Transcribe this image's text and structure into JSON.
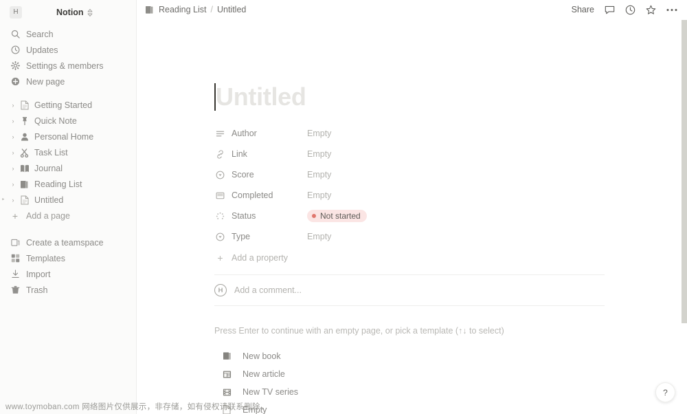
{
  "sidebar": {
    "workspace": {
      "avatar_initial": "H",
      "name": "Notion",
      "switcher_icon": "chevron-updown-icon"
    },
    "nav": [
      {
        "label": "Search",
        "icon": "search-icon"
      },
      {
        "label": "Updates",
        "icon": "clock-icon"
      },
      {
        "label": "Settings & members",
        "icon": "gear-icon"
      },
      {
        "label": "New page",
        "icon": "plus-circle-icon"
      }
    ],
    "pages": [
      {
        "label": "Getting Started",
        "icon": "document-icon"
      },
      {
        "label": "Quick Note",
        "icon": "pushpin-icon"
      },
      {
        "label": "Personal Home",
        "icon": "person-icon"
      },
      {
        "label": "Task List",
        "icon": "scissors-icon"
      },
      {
        "label": "Journal",
        "icon": "open-book-icon"
      },
      {
        "label": "Reading List",
        "icon": "books-icon"
      },
      {
        "label": "Untitled",
        "icon": "document-icon"
      }
    ],
    "add_page": {
      "label": "Add a page",
      "icon": "plus-icon"
    },
    "footer": [
      {
        "label": "Create a teamspace",
        "icon": "teamspace-icon"
      },
      {
        "label": "Templates",
        "icon": "templates-icon"
      },
      {
        "label": "Import",
        "icon": "import-icon"
      },
      {
        "label": "Trash",
        "icon": "trash-icon"
      }
    ]
  },
  "topbar": {
    "breadcrumb_parent": "Reading List",
    "breadcrumb_parent_icon": "books-icon",
    "breadcrumb_separator": "/",
    "breadcrumb_current": "Untitled",
    "share_label": "Share",
    "actions": [
      {
        "name": "comment-icon"
      },
      {
        "name": "updates-clock-icon"
      },
      {
        "name": "star-icon"
      },
      {
        "name": "more-options-icon"
      }
    ]
  },
  "page": {
    "title_placeholder": "Untitled",
    "properties": [
      {
        "label": "Author",
        "icon": "text-lines-icon",
        "value": "Empty",
        "type": "text"
      },
      {
        "label": "Link",
        "icon": "link-icon",
        "value": "Empty",
        "type": "text"
      },
      {
        "label": "Score",
        "icon": "select-icon",
        "value": "Empty",
        "type": "text"
      },
      {
        "label": "Completed",
        "icon": "checkbox-icon",
        "value": "Empty",
        "type": "text"
      },
      {
        "label": "Status",
        "icon": "status-spinner-icon",
        "value": "Not started",
        "type": "badge"
      },
      {
        "label": "Type",
        "icon": "select-icon",
        "value": "Empty",
        "type": "text"
      }
    ],
    "add_property_label": "Add a property",
    "comment": {
      "avatar_initial": "H",
      "placeholder": "Add a comment..."
    },
    "template_hint": "Press Enter to continue with an empty page, or pick a template (↑↓ to select)",
    "templates": [
      {
        "label": "New book",
        "icon": "book-template-icon"
      },
      {
        "label": "New article",
        "icon": "article-template-icon"
      },
      {
        "label": "New TV series",
        "icon": "tv-template-icon"
      },
      {
        "label": "Empty",
        "icon": "empty-template-icon"
      }
    ]
  },
  "help_button_label": "?",
  "watermark": "www.toymoban.com 网络图片仅供展示，非存储，如有侵权请联系删除。",
  "colors": {
    "sidebar_bg": "#fbfbfa",
    "badge_bg": "#fbe5e4",
    "badge_dot": "#e0776e",
    "text_primary": "#37352f",
    "text_muted": "#8a8986"
  }
}
